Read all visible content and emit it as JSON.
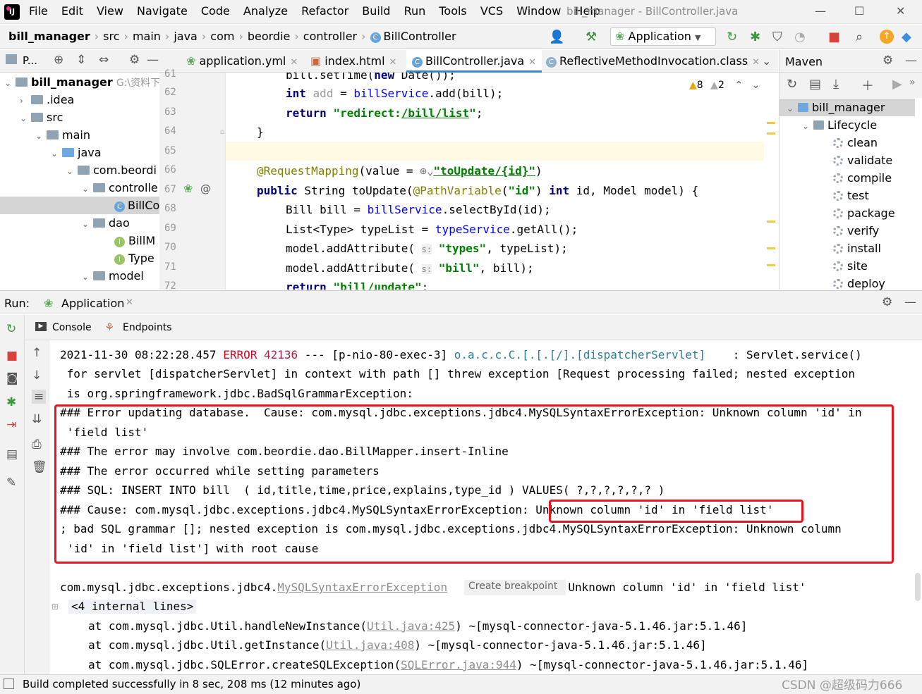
{
  "titlebar": {
    "menu": [
      "File",
      "Edit",
      "View",
      "Navigate",
      "Code",
      "Analyze",
      "Refactor",
      "Build",
      "Run",
      "Tools",
      "VCS",
      "Window",
      "Help"
    ],
    "window_title": "bill_manager - BillController.java"
  },
  "navbar": {
    "breadcrumbs": [
      "bill_manager",
      "src",
      "main",
      "java",
      "com",
      "beordie",
      "controller",
      "BillController"
    ],
    "run_config": "Application"
  },
  "project": {
    "header_label": "P...",
    "tree": [
      {
        "label": "bill_manager",
        "note": "G:\\资料下载"
      },
      {
        "label": ".idea"
      },
      {
        "label": "src"
      },
      {
        "label": "main"
      },
      {
        "label": "java"
      },
      {
        "label": "com.beordi"
      },
      {
        "label": "controlle"
      },
      {
        "label": "BillCo"
      },
      {
        "label": "dao"
      },
      {
        "label": "BillM"
      },
      {
        "label": "Type"
      },
      {
        "label": "model"
      }
    ]
  },
  "editor": {
    "tabs": [
      "application.yml",
      "index.html",
      "BillController.java",
      "ReflectiveMethodInvocation.class"
    ],
    "active_tab": "BillController.java",
    "warnings": "8",
    "weak_warnings": "2",
    "line_numbers": [
      "61",
      "62",
      "63",
      "64",
      "65",
      "66",
      "67",
      "68",
      "69",
      "70",
      "71",
      "72"
    ]
  },
  "maven": {
    "title": "Maven",
    "project": "bill_manager",
    "lifecycle_label": "Lifecycle",
    "lifecycle": [
      "clean",
      "validate",
      "compile",
      "test",
      "package",
      "verify",
      "install",
      "site",
      "deploy"
    ]
  },
  "run": {
    "label": "Run:",
    "tab": "Application",
    "subtabs": [
      "Console",
      "Endpoints"
    ]
  },
  "console": {
    "lines": [
      "2021-11-30 08:22:28.457 ERROR 42136 --- [p-nio-80-exec-3] o.a.c.c.C.[.[.[/].[dispatcherServlet]    : Servlet.service()",
      " for servlet [dispatcherServlet] in context with path [] threw exception [Request processing failed; nested exception",
      " is org.springframework.jdbc.BadSqlGrammarException:",
      "### Error updating database.  Cause: com.mysql.jdbc.exceptions.jdbc4.MySQLSyntaxErrorException: Unknown column 'id' in",
      " 'field list'",
      "### The error may involve com.beordie.dao.BillMapper.insert-Inline",
      "### The error occurred while setting parameters",
      "### SQL: INSERT INTO bill  ( id,title,time,price,explains,type_id ) VALUES( ?,?,?,?,?,? )",
      "### Cause: com.mysql.jdbc.exceptions.jdbc4.MySQLSyntaxErrorException: Unknown column 'id' in 'field list'",
      "; bad SQL grammar []; nested exception is com.mysql.jdbc.exceptions.jdbc4.MySQLSyntaxErrorException: Unknown column",
      "'id' in 'field list'] with root cause"
    ],
    "exception_prefix": "com.mysql.jdbc.exceptions.jdbc4.",
    "exception_link": "MySQLSyntaxErrorException",
    "create_breakpoint": "Create breakpoint",
    "exception_suffix": ": Unknown column 'id' in 'field list'",
    "internal_lines": "<4 internal lines>",
    "stack": [
      {
        "pre": "at com.mysql.jdbc.Util.handleNewInstance(",
        "link": "Util.java:425",
        "post": ") ~[mysql-connector-java-5.1.46.jar:5.1.46]"
      },
      {
        "pre": "at com.mysql.jdbc.Util.getInstance(",
        "link": "Util.java:408",
        "post": ") ~[mysql-connector-java-5.1.46.jar:5.1.46]"
      },
      {
        "pre": "at com.mysql.jdbc.SQLError.createSQLException(",
        "link": "SQLError.java:944",
        "post": ") ~[mysql-connector-java-5.1.46.jar:5.1.46]"
      }
    ]
  },
  "statusbar": {
    "message": "Build completed successfully in 8 sec, 208 ms (12 minutes ago)",
    "watermark": "CSDN @超级码力666"
  },
  "colors": {
    "accent": "#4083c9",
    "error_box": "#e8141f",
    "error_text": "#d0021b"
  }
}
